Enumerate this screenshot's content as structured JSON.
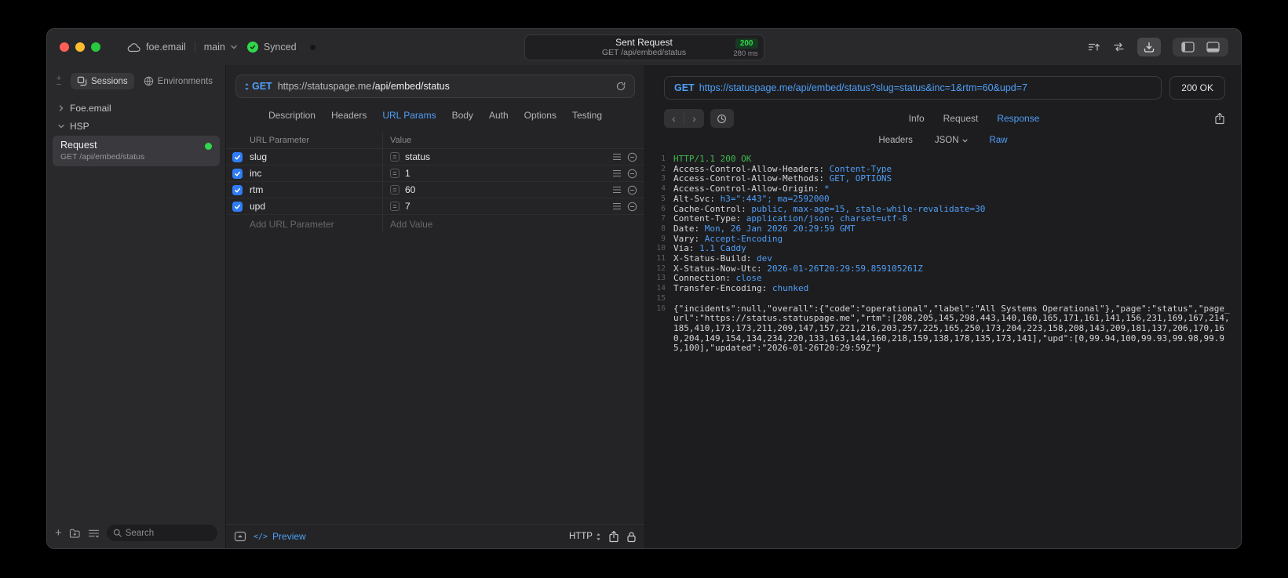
{
  "titlebar": {
    "project": "foe.email",
    "branch": "main",
    "sync_status": "Synced",
    "request_title": "Sent Request",
    "request_subtitle": "GET /api/embed/status",
    "status_code": "200",
    "duration": "280 ms"
  },
  "sidebar": {
    "tabs": [
      {
        "label": "Sessions",
        "active": true
      },
      {
        "label": "Environments",
        "active": false
      }
    ],
    "tree": [
      {
        "label": "Foe.email",
        "expanded": false
      },
      {
        "label": "HSP",
        "expanded": true
      }
    ],
    "request_item": {
      "title": "Request",
      "subtitle": "GET /api/embed/status"
    },
    "search_placeholder": "Search"
  },
  "request_pane": {
    "method": "GET",
    "url_domain": "https://statuspage.me",
    "url_path": "/api/embed/status",
    "tabs": [
      "Description",
      "Headers",
      "URL Params",
      "Body",
      "Auth",
      "Options",
      "Testing"
    ],
    "active_tab": "URL Params",
    "table": {
      "columns": [
        "URL Parameter",
        "Value"
      ],
      "rows": [
        {
          "enabled": true,
          "name": "slug",
          "value": "status"
        },
        {
          "enabled": true,
          "name": "inc",
          "value": "1"
        },
        {
          "enabled": true,
          "name": "rtm",
          "value": "60"
        },
        {
          "enabled": true,
          "name": "upd",
          "value": "7"
        }
      ],
      "add_name_placeholder": "Add URL Parameter",
      "add_value_placeholder": "Add Value"
    },
    "footer": {
      "code_glyph": "</>",
      "preview_label": "Preview",
      "protocol": "HTTP"
    }
  },
  "response_pane": {
    "method": "GET",
    "url": "https://statuspage.me/api/embed/status?slug=status&inc=1&rtm=60&upd=7",
    "status": "200 OK",
    "tabs": [
      "Info",
      "Request",
      "Response"
    ],
    "active_tab": "Response",
    "subtabs": {
      "headers": "Headers",
      "format": "JSON",
      "raw": "Raw"
    },
    "active_subtab": "Raw",
    "lines": [
      {
        "n": 1,
        "type": "status",
        "text": "HTTP/1.1 200 OK"
      },
      {
        "n": 2,
        "type": "header",
        "name": "Access-Control-Allow-Headers",
        "value": "Content-Type"
      },
      {
        "n": 3,
        "type": "header",
        "name": "Access-Control-Allow-Methods",
        "value": "GET, OPTIONS"
      },
      {
        "n": 4,
        "type": "header",
        "name": "Access-Control-Allow-Origin",
        "value": "*"
      },
      {
        "n": 5,
        "type": "header",
        "name": "Alt-Svc",
        "value": "h3=\":443\"; ma=2592000"
      },
      {
        "n": 6,
        "type": "header",
        "name": "Cache-Control",
        "value": "public, max-age=15, stale-while-revalidate=30"
      },
      {
        "n": 7,
        "type": "header",
        "name": "Content-Type",
        "value": "application/json; charset=utf-8"
      },
      {
        "n": 8,
        "type": "header",
        "name": "Date",
        "value": "Mon, 26 Jan 2026 20:29:59 GMT"
      },
      {
        "n": 9,
        "type": "header",
        "name": "Vary",
        "value": "Accept-Encoding"
      },
      {
        "n": 10,
        "type": "header",
        "name": "Via",
        "value": "1.1 Caddy"
      },
      {
        "n": 11,
        "type": "header",
        "name": "X-Status-Build",
        "value": "dev"
      },
      {
        "n": 12,
        "type": "header",
        "name": "X-Status-Now-Utc",
        "value": "2026-01-26T20:29:59.859105261Z"
      },
      {
        "n": 13,
        "type": "header",
        "name": "Connection",
        "value": "close"
      },
      {
        "n": 14,
        "type": "header",
        "name": "Transfer-Encoding",
        "value": "chunked"
      },
      {
        "n": 15,
        "type": "blank"
      },
      {
        "n": 16,
        "type": "body",
        "text": "{\"incidents\":null,\"overall\":{\"code\":\"operational\",\"label\":\"All Systems Operational\"},\"page\":\"status\",\"page_url\":\"https://status.statuspage.me\",\"rtm\":[208,205,145,298,443,140,160,165,171,161,141,156,231,169,167,214,185,410,173,173,211,209,147,157,221,216,203,257,225,165,250,173,204,223,158,208,143,209,181,137,206,170,160,204,149,154,134,234,220,133,163,144,160,218,159,138,178,135,173,141],\"upd\":[0,99.94,100,99.93,99.98,99.95,100],\"updated\":\"2026-01-26T20:29:59Z\"}"
      }
    ]
  },
  "colors": {
    "accent_blue": "#4f9ff8",
    "green": "#32d74b",
    "checkbox_blue": "#2f7cf6",
    "status_green": "#3fb950"
  }
}
